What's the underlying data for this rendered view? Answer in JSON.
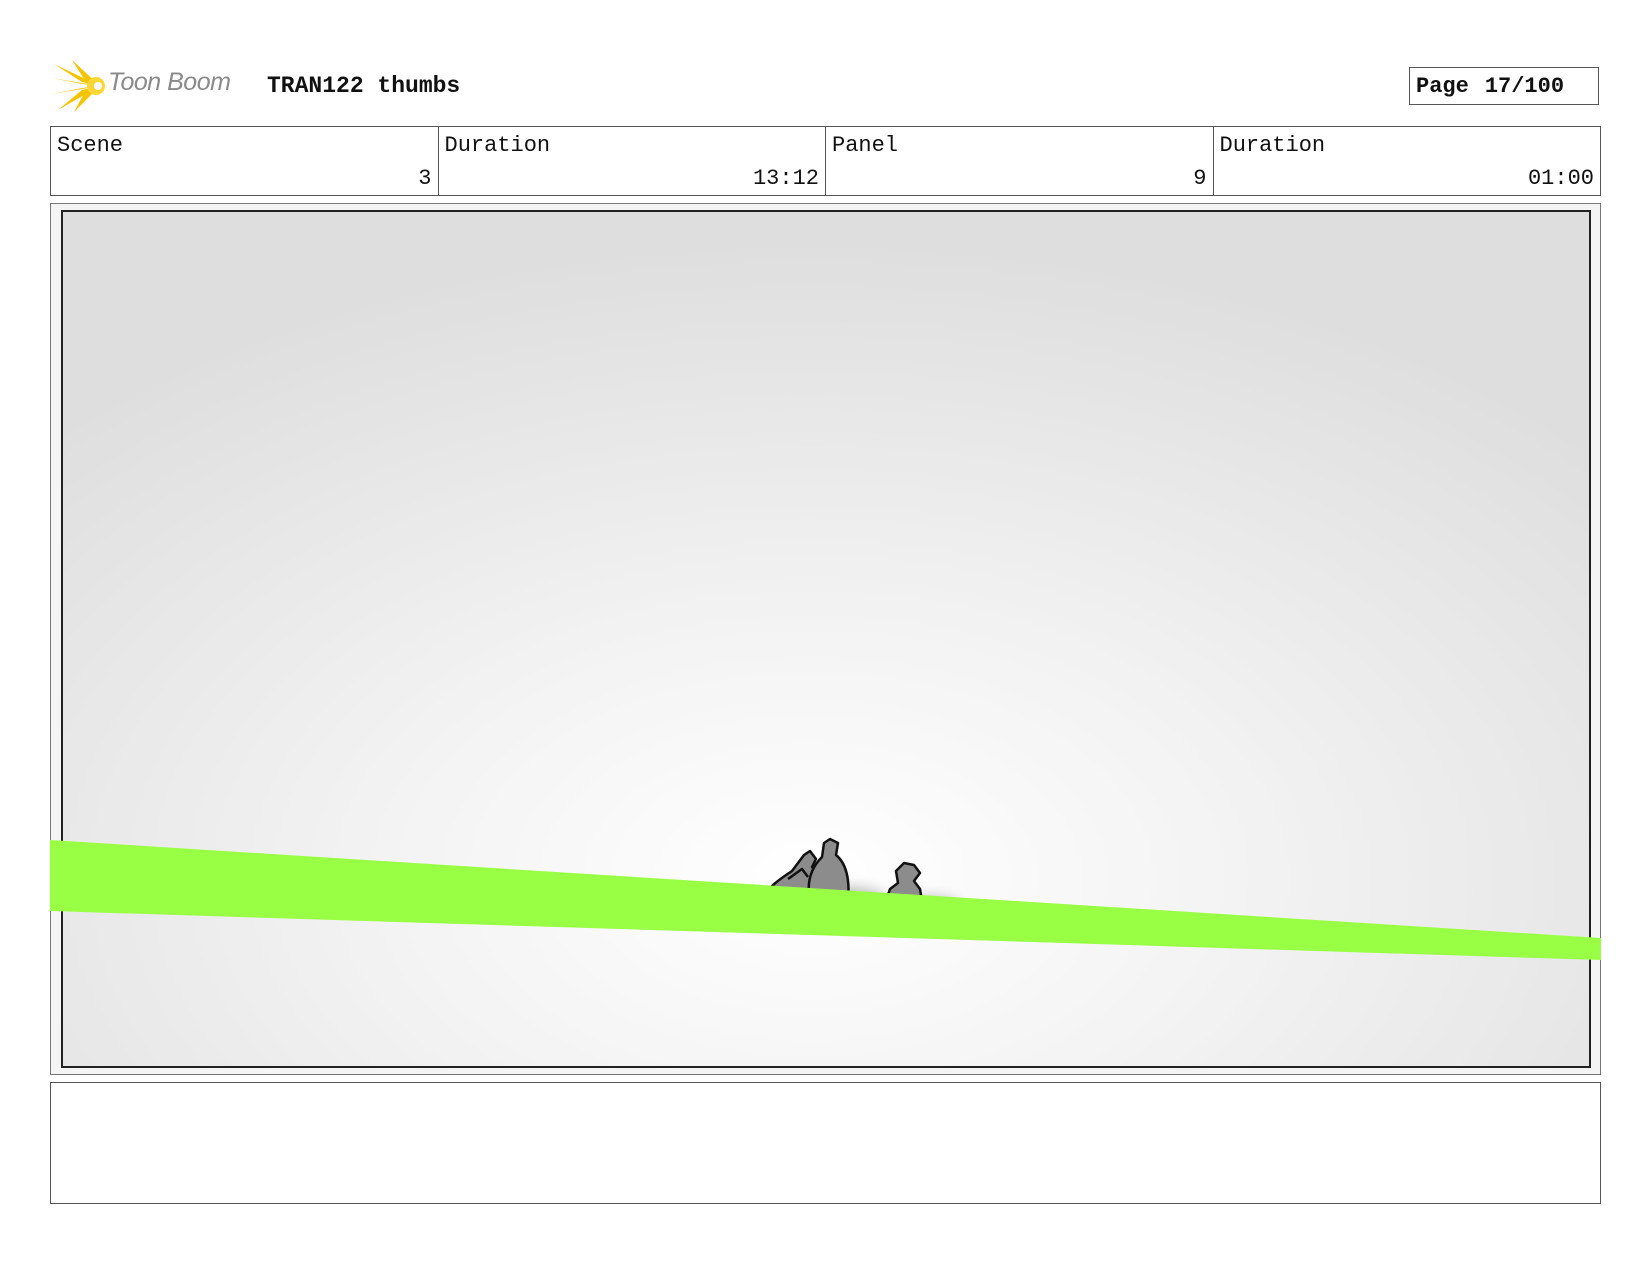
{
  "header": {
    "logo_text": "Toon Boom",
    "project_title": "TRAN122 thumbs",
    "page_label": "Page",
    "page_value": "17/100"
  },
  "info": {
    "scene_label": "Scene",
    "scene_value": "3",
    "scene_duration_label": "Duration",
    "scene_duration_value": "13:12",
    "panel_label": "Panel",
    "panel_value": "9",
    "panel_duration_label": "Duration",
    "panel_duration_value": "01:00"
  },
  "colors": {
    "ground_stripe": "#99ff44",
    "figure_fill": "#8c8c8c",
    "logo_burst": "#f5c400"
  },
  "notes": {
    "text": ""
  }
}
